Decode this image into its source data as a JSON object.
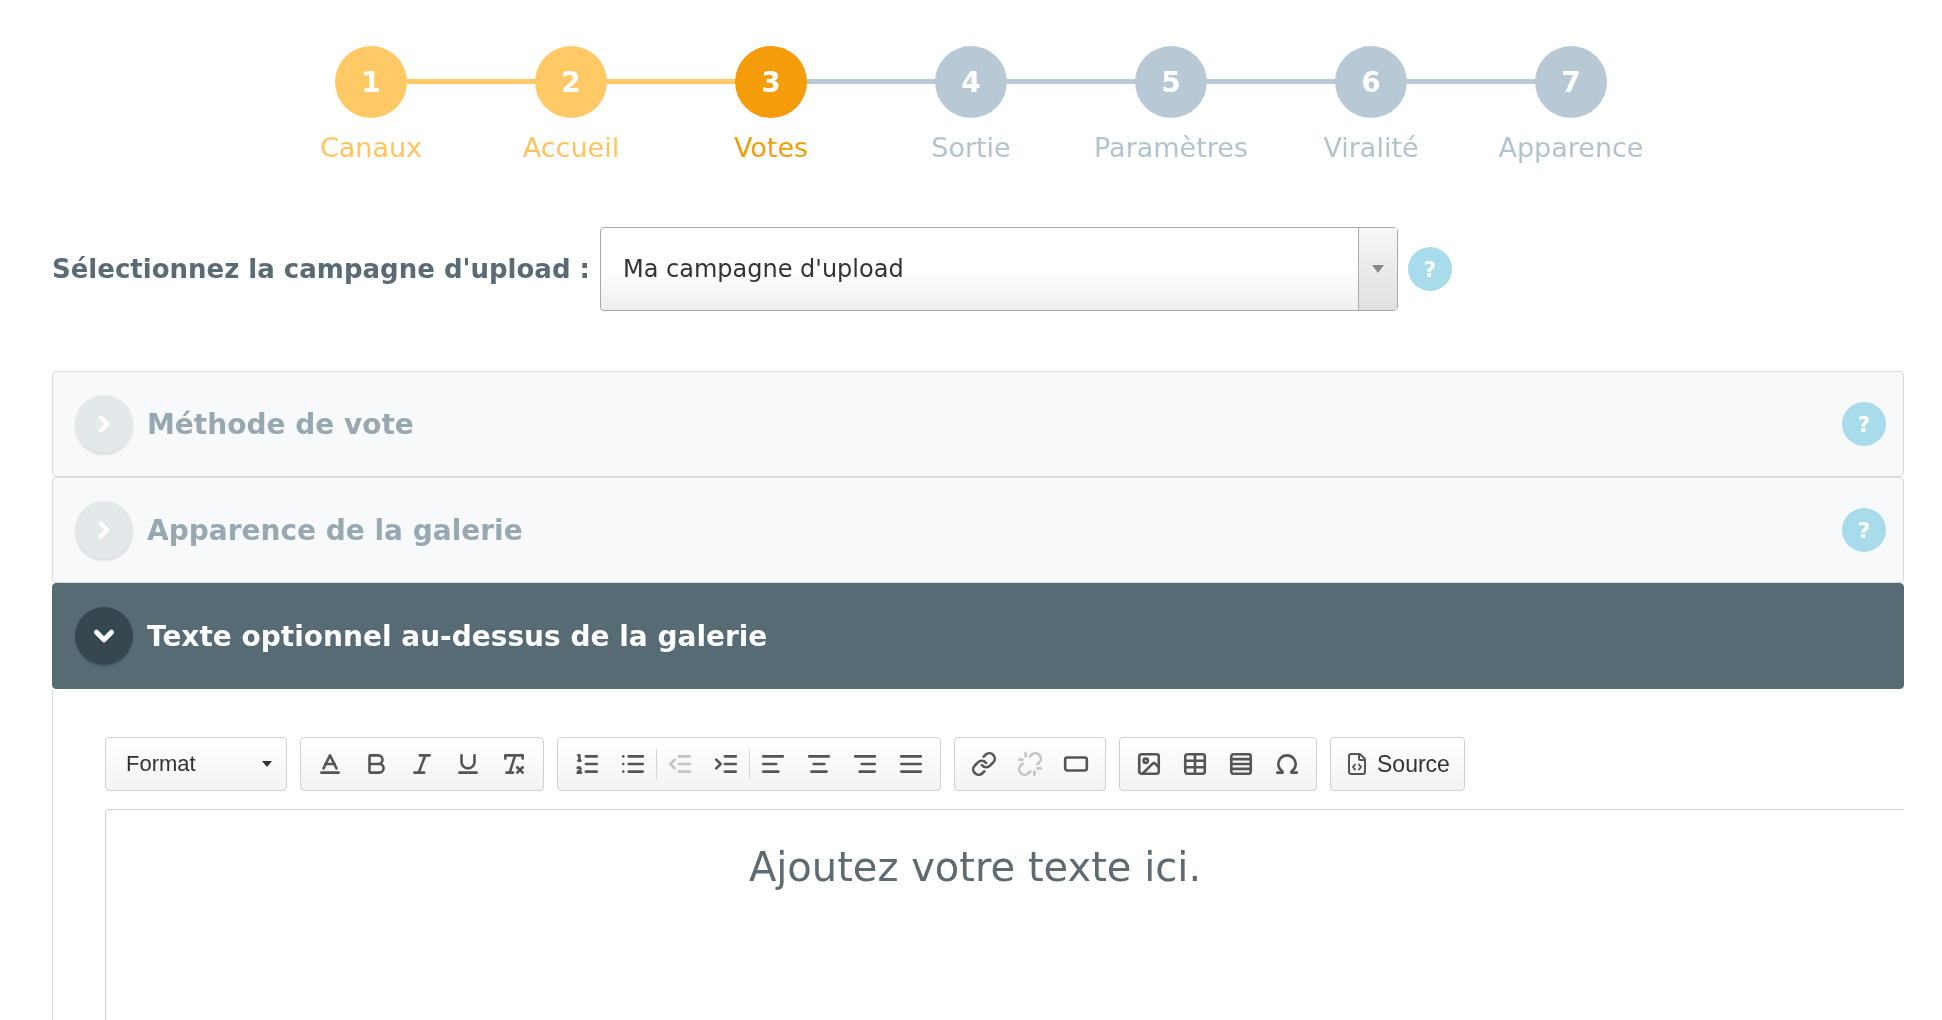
{
  "steps": [
    {
      "number": "1",
      "label": "Canaux",
      "done": true,
      "selected": false
    },
    {
      "number": "2",
      "label": "Accueil",
      "done": true,
      "selected": false
    },
    {
      "number": "3",
      "label": "Votes",
      "done": false,
      "selected": true
    },
    {
      "number": "4",
      "label": "Sortie",
      "done": false,
      "selected": false
    },
    {
      "number": "5",
      "label": "Paramètres",
      "done": false,
      "selected": false
    },
    {
      "number": "6",
      "label": "Viralité",
      "done": false,
      "selected": false
    },
    {
      "number": "7",
      "label": "Apparence",
      "done": false,
      "selected": false
    }
  ],
  "campaign": {
    "label": "Sélectionnez la campagne d'upload :",
    "value": "Ma campagne d'upload",
    "help": "?"
  },
  "panels": [
    {
      "title": "Méthode de vote",
      "expanded": false,
      "help": "?"
    },
    {
      "title": "Apparence de la galerie",
      "expanded": false,
      "help": "?"
    },
    {
      "title": "Texte optionnel au-dessus de la galerie",
      "expanded": true
    }
  ],
  "editor": {
    "format": "Format",
    "groups": [
      [
        {
          "disabled": false
        },
        {
          "disabled": false
        },
        {
          "disabled": false
        },
        {
          "disabled": false
        },
        {
          "disabled": false
        }
      ],
      [
        {
          "disabled": false
        },
        {
          "disabled": false
        },
        {
          "disabled": true
        },
        {
          "disabled": false
        },
        {
          "disabled": false
        },
        {
          "disabled": false
        },
        {
          "disabled": false
        },
        {
          "disabled": false
        }
      ],
      [
        {
          "disabled": false
        },
        {
          "disabled": true
        },
        {
          "disabled": false
        }
      ],
      [
        {
          "disabled": false
        },
        {
          "disabled": false
        },
        {
          "disabled": false
        },
        {
          "disabled": false
        }
      ]
    ],
    "source": "Source",
    "text": "Ajoutez votre texte ici."
  }
}
